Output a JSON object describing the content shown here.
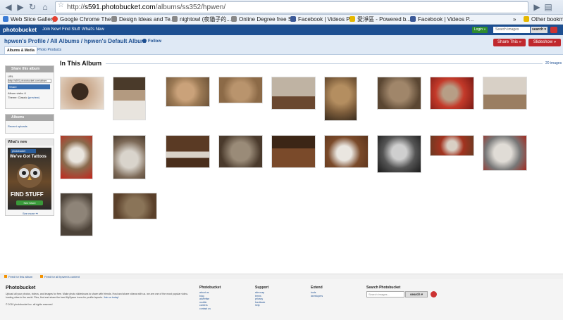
{
  "browser": {
    "url_prefix": "http://",
    "url_host": "s591.photobucket.com",
    "url_path": "/albums/ss352/hpwen/",
    "bookmarks": [
      {
        "label": "Web Slice Gallery",
        "color": "#3a7bd5"
      },
      {
        "label": "Google Chrome The...",
        "color": "#e34133"
      },
      {
        "label": "Design Ideas and Te...",
        "color": "#7a7a7a"
      },
      {
        "label": "nightowl (夜貓子的...",
        "color": "#7a7a7a"
      },
      {
        "label": "Online Degree free S...",
        "color": "#7a7a7a"
      },
      {
        "label": "Facebook | Videos P...",
        "color": "#3b5998"
      },
      {
        "label": "愛淨區 - Powered b...",
        "color": "#e6b800"
      },
      {
        "label": "Facebook | Videos P...",
        "color": "#3b5998"
      }
    ],
    "other_bookmarks": "Other bookma"
  },
  "pb_header": {
    "logo": "photobucket",
    "nav": [
      "Join Now!",
      "Find Stuff",
      "What's New"
    ],
    "login": "Login »",
    "search_placeholder": "Search images",
    "search_button": "search ▾"
  },
  "album_header": {
    "crumb_profile": "hpwen's Profile",
    "crumb_sep1": " / ",
    "crumb_all": "All Albums",
    "crumb_sep2": " / ",
    "crumb_album": "hpwen's Default Album",
    "follow": "Follow",
    "share_this": "Share This »",
    "slideshow": "Slideshow »",
    "tabs": [
      "Albums & Media",
      "Photo Products"
    ]
  },
  "sidebar": {
    "share_title": "Share this album",
    "url_label": "URL",
    "url_value": "http://s591.photobucket.com/album",
    "share_button": "Share",
    "album_visits": "Album visits: 6",
    "theme_label": "Theme: Classic",
    "theme_preview": "(preview)",
    "albums_title": "Albums",
    "recent_uploads": "Recent uploads",
    "whats_new_title": "What's new",
    "ad_logo": "photobucket",
    "ad_line1": "We've Got Tattoos",
    "ad_line2": "FIND STUFF",
    "ad_button": "See More",
    "see_more": "See more"
  },
  "album": {
    "title": "In This Album",
    "count": "20 images"
  },
  "footer": {
    "feed1": "Feed for this album",
    "feed2": "Feed for all hpwen's content",
    "brand": "Photobucket",
    "blurb": "Upload all your photos, videos, and images for free. Make photo slideshows to share with friends. Host and share videos with us. we are one of the most popular video-hosting sites in the world. Plus, find and share the best MySpace icons for profile layouts.",
    "join_today": "Join us today!",
    "copyright": "© 2010 photobucket inc. all rights reserved",
    "col1_title": "Photobucket",
    "col1_links": [
      "about us",
      "blog",
      "advertise",
      "mobile",
      "careers",
      "contact us"
    ],
    "col2_title": "Support",
    "col2_links": [
      "site map",
      "terms",
      "privacy",
      "feedback",
      "help"
    ],
    "col3_title": "Extend",
    "col3_links": [
      "tools",
      "developers"
    ],
    "search_title": "Search Photobucket",
    "search_placeholder": "Search images...",
    "search_button": "search ▾"
  },
  "icons": {
    "back": "back-arrow-icon",
    "forward": "forward-arrow-icon",
    "reload": "reload-icon",
    "home": "home-icon",
    "star": "star-icon",
    "go": "go-arrow-icon",
    "page": "page-menu-icon"
  }
}
